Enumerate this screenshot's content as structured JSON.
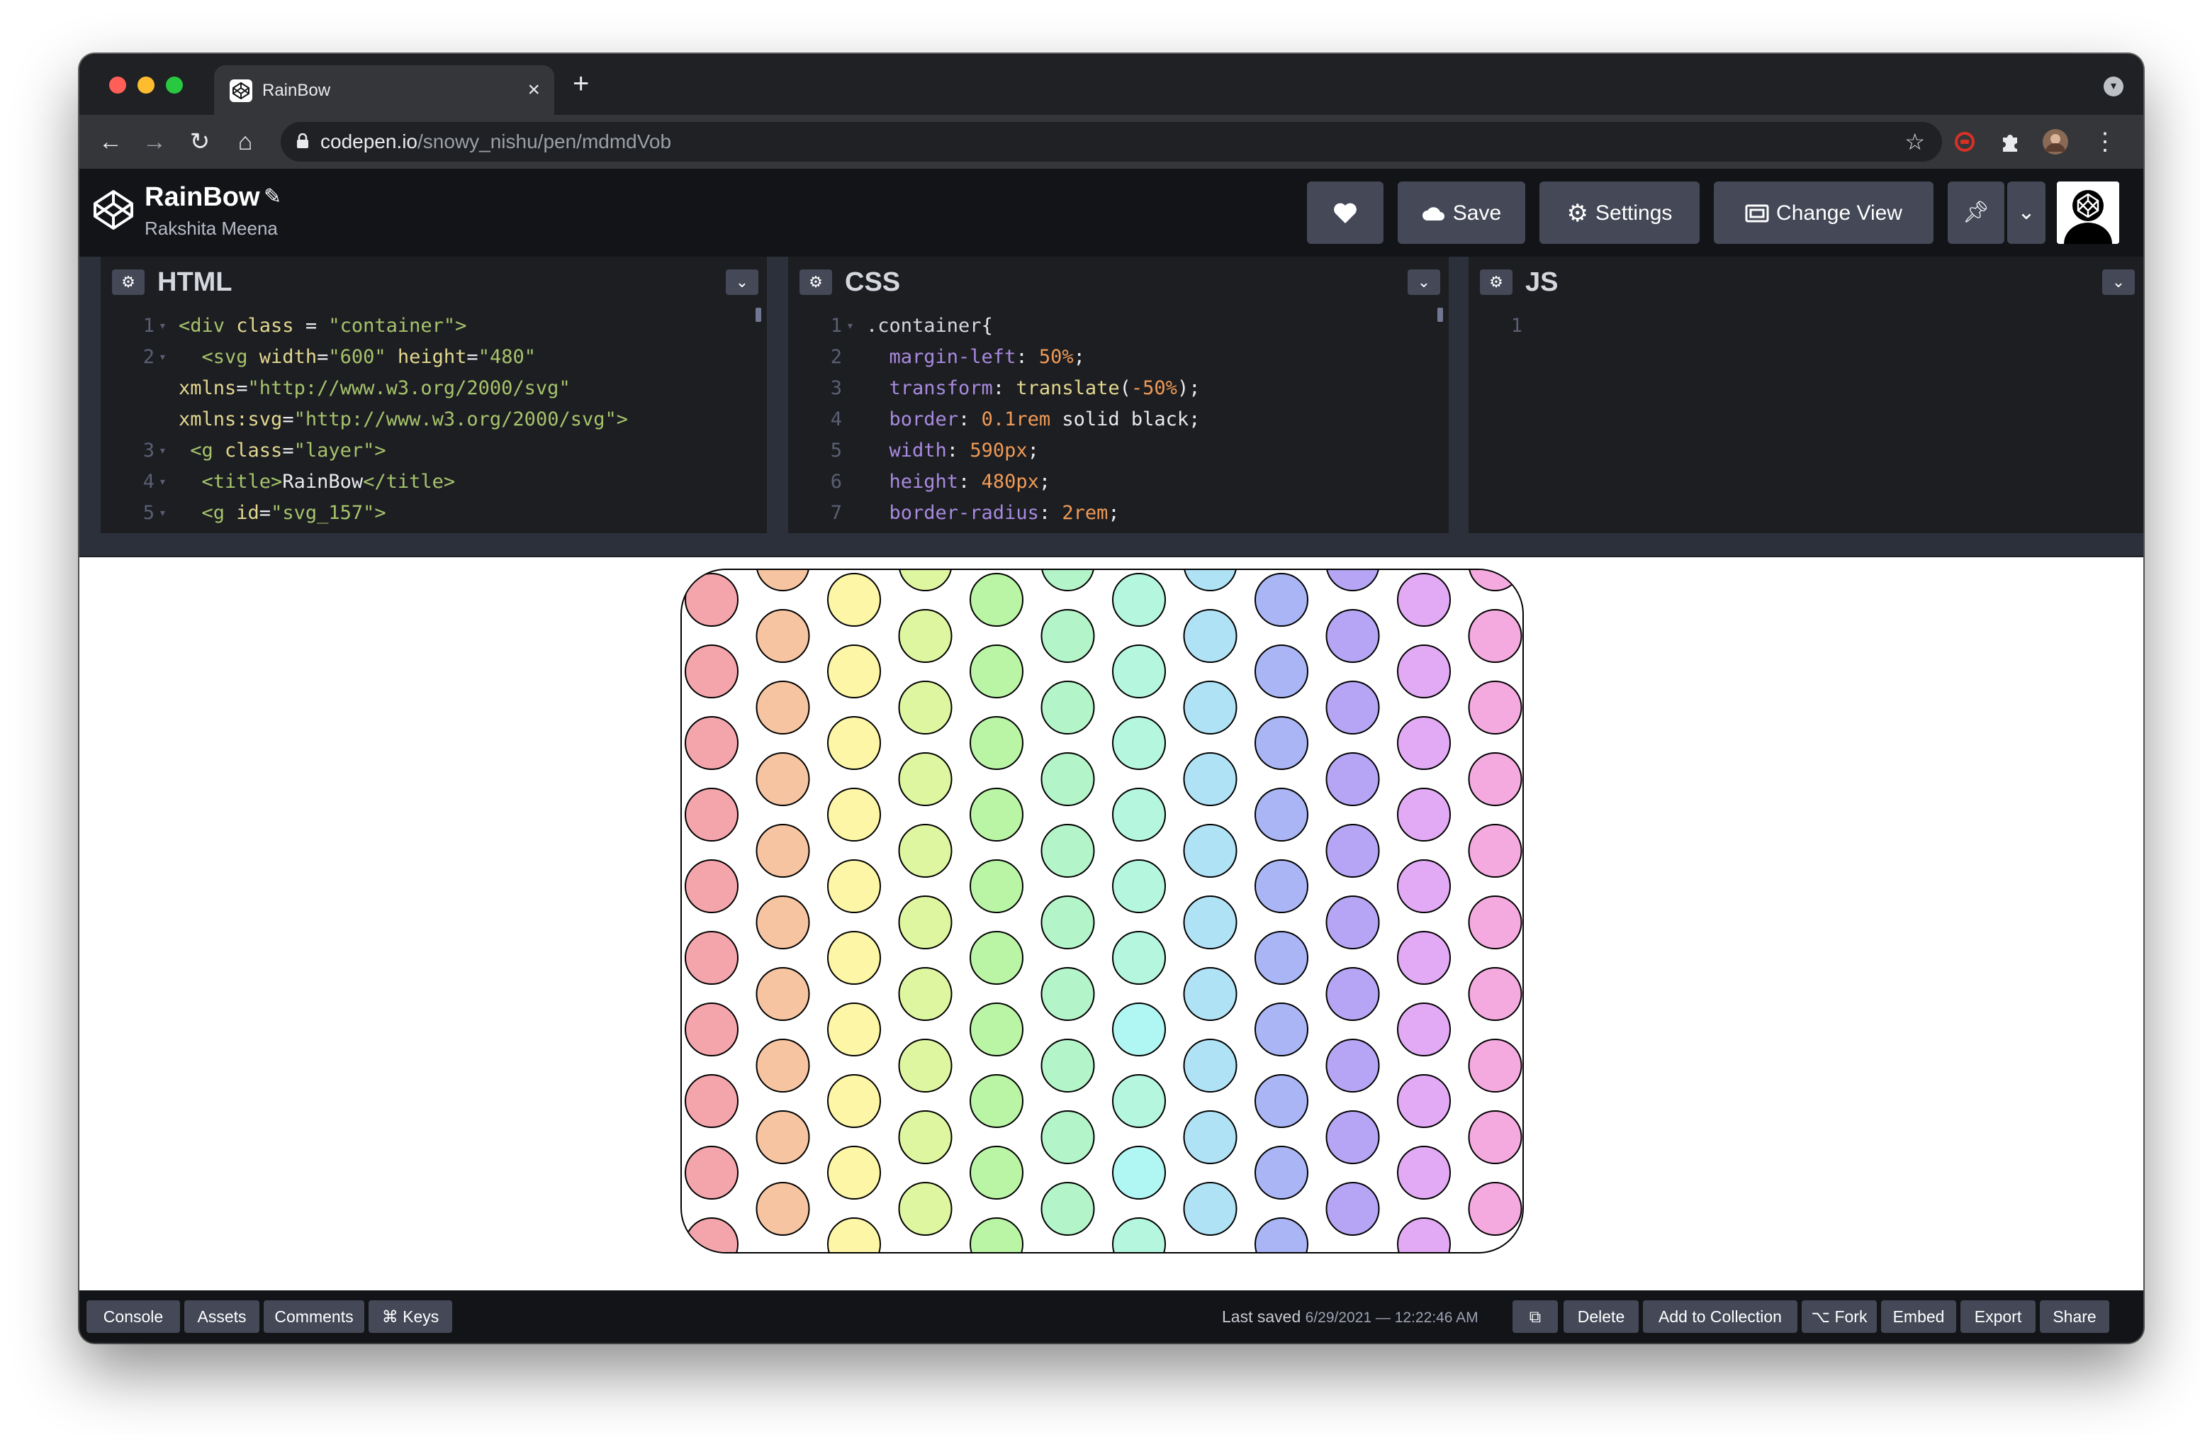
{
  "browser": {
    "tab_title": "RainBow",
    "tab_close": "×",
    "new_tab": "+",
    "url_host": "codepen.io",
    "url_path": "/snowy_nishu/pen/mdmdVob"
  },
  "codepen": {
    "pen_title": "RainBow",
    "author": "Rakshita Meena",
    "buttons": {
      "save": "Save",
      "settings": "Settings",
      "change_view": "Change View"
    }
  },
  "editors": {
    "html": {
      "title": "HTML",
      "lines": [
        {
          "n": "1",
          "fold": true,
          "segments": [
            {
              "t": "<div ",
              "c": "tok-tag"
            },
            {
              "t": "class",
              "c": "tok-attr"
            },
            {
              "t": " = ",
              "c": "tok-plain"
            },
            {
              "t": "\"container\"",
              "c": "tok-str"
            },
            {
              "t": ">",
              "c": "tok-tag"
            }
          ]
        },
        {
          "n": "2",
          "fold": true,
          "segments": [
            {
              "t": "  <svg ",
              "c": "tok-tag"
            },
            {
              "t": "width",
              "c": "tok-attr"
            },
            {
              "t": "=",
              "c": "tok-plain"
            },
            {
              "t": "\"600\"",
              "c": "tok-str"
            },
            {
              "t": " height",
              "c": "tok-attr"
            },
            {
              "t": "=",
              "c": "tok-plain"
            },
            {
              "t": "\"480\"",
              "c": "tok-str"
            }
          ]
        },
        {
          "n": "",
          "fold": false,
          "segments": [
            {
              "t": "xmlns",
              "c": "tok-attr"
            },
            {
              "t": "=",
              "c": "tok-plain"
            },
            {
              "t": "\"http://www.w3.org/2000/svg\"",
              "c": "tok-str"
            }
          ]
        },
        {
          "n": "",
          "fold": false,
          "segments": [
            {
              "t": "xmlns:svg",
              "c": "tok-attr"
            },
            {
              "t": "=",
              "c": "tok-plain"
            },
            {
              "t": "\"http://www.w3.org/2000/svg\"",
              "c": "tok-str"
            },
            {
              "t": ">",
              "c": "tok-tag"
            }
          ]
        },
        {
          "n": "3",
          "fold": true,
          "segments": [
            {
              "t": " <g ",
              "c": "tok-tag"
            },
            {
              "t": "class",
              "c": "tok-attr"
            },
            {
              "t": "=",
              "c": "tok-plain"
            },
            {
              "t": "\"layer\"",
              "c": "tok-str"
            },
            {
              "t": ">",
              "c": "tok-tag"
            }
          ]
        },
        {
          "n": "4",
          "fold": true,
          "segments": [
            {
              "t": "  <title>",
              "c": "tok-tag"
            },
            {
              "t": "RainBow",
              "c": "tok-plain"
            },
            {
              "t": "</title>",
              "c": "tok-tag"
            }
          ]
        },
        {
          "n": "5",
          "fold": true,
          "segments": [
            {
              "t": "  <g ",
              "c": "tok-tag"
            },
            {
              "t": "id",
              "c": "tok-attr"
            },
            {
              "t": "=",
              "c": "tok-plain"
            },
            {
              "t": "\"svg_157\"",
              "c": "tok-str"
            },
            {
              "t": ">",
              "c": "tok-tag"
            }
          ]
        }
      ]
    },
    "css": {
      "title": "CSS",
      "lines": [
        {
          "n": "1",
          "fold": true,
          "segments": [
            {
              "t": ".container",
              "c": "tok-sel"
            },
            {
              "t": "{",
              "c": "tok-plain"
            }
          ]
        },
        {
          "n": "2",
          "fold": false,
          "segments": [
            {
              "t": "  margin-left",
              "c": "tok-prop"
            },
            {
              "t": ": ",
              "c": "tok-plain"
            },
            {
              "t": "50%",
              "c": "tok-num"
            },
            {
              "t": ";",
              "c": "tok-plain"
            }
          ]
        },
        {
          "n": "3",
          "fold": false,
          "segments": [
            {
              "t": "  transform",
              "c": "tok-prop"
            },
            {
              "t": ": ",
              "c": "tok-plain"
            },
            {
              "t": "translate",
              "c": "tok-kw"
            },
            {
              "t": "(",
              "c": "tok-plain"
            },
            {
              "t": "-50%",
              "c": "tok-num"
            },
            {
              "t": ");",
              "c": "tok-plain"
            }
          ]
        },
        {
          "n": "4",
          "fold": false,
          "segments": [
            {
              "t": "  border",
              "c": "tok-prop"
            },
            {
              "t": ": ",
              "c": "tok-plain"
            },
            {
              "t": "0.1rem",
              "c": "tok-num"
            },
            {
              "t": " solid black;",
              "c": "tok-plain"
            }
          ]
        },
        {
          "n": "5",
          "fold": false,
          "segments": [
            {
              "t": "  width",
              "c": "tok-prop"
            },
            {
              "t": ": ",
              "c": "tok-plain"
            },
            {
              "t": "590px",
              "c": "tok-num"
            },
            {
              "t": ";",
              "c": "tok-plain"
            }
          ]
        },
        {
          "n": "6",
          "fold": false,
          "segments": [
            {
              "t": "  height",
              "c": "tok-prop"
            },
            {
              "t": ": ",
              "c": "tok-plain"
            },
            {
              "t": "480px",
              "c": "tok-num"
            },
            {
              "t": ";",
              "c": "tok-plain"
            }
          ]
        },
        {
          "n": "7",
          "fold": false,
          "segments": [
            {
              "t": "  border-radius",
              "c": "tok-prop"
            },
            {
              "t": ": ",
              "c": "tok-plain"
            },
            {
              "t": "2rem",
              "c": "tok-num"
            },
            {
              "t": ";",
              "c": "tok-plain"
            }
          ]
        }
      ]
    },
    "js": {
      "title": "JS",
      "lines": [
        {
          "n": "1",
          "fold": false,
          "segments": []
        }
      ]
    }
  },
  "preview": {
    "column_colors": [
      "#f4a5ab",
      "#f6c4a0",
      "#fdf6a6",
      "#dff6a0",
      "#baf5a5",
      "#b4f4c9",
      "#b5f6df",
      "#b0e2f6",
      "#a9b5f4",
      "#b5a5f4",
      "#e2a9f4",
      "#f4a9df"
    ],
    "accent_colors": {
      "aqua": "#b0f6f2"
    }
  },
  "footer": {
    "console": "Console",
    "assets": "Assets",
    "comments": "Comments",
    "keys": "⌘ Keys",
    "last_saved_label": "Last saved",
    "last_saved_date": "6/29/2021 — 12:22:46 AM",
    "delete": "Delete",
    "add_to_collection": "Add to Collection",
    "fork": "⌥ Fork",
    "embed": "Embed",
    "export": "Export",
    "share": "Share"
  }
}
